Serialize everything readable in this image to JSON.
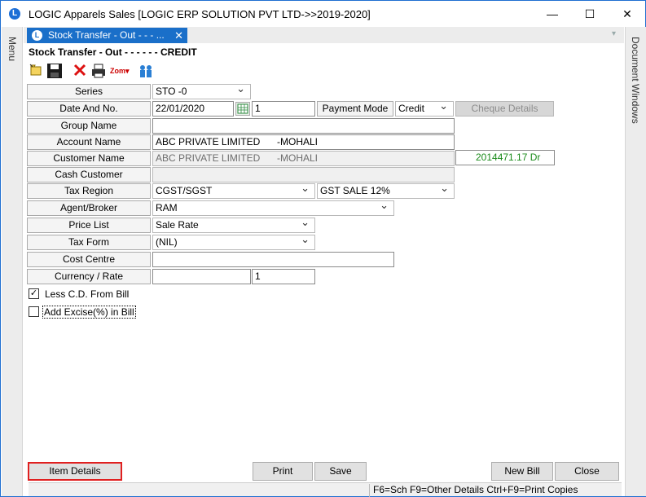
{
  "window": {
    "title": "LOGIC Apparels Sales  [LOGIC ERP SOLUTION PVT LTD->>2019-2020]",
    "logo_letter": "L",
    "minimize": "—",
    "maximize": "☐",
    "close": "✕"
  },
  "sidebars": {
    "left": "Menu",
    "right": "Document Windows"
  },
  "tab": {
    "label": "Stock Transfer - Out -  - - ...",
    "close": "✕",
    "logo_letter": "L",
    "overflow": "▾"
  },
  "form_header": "Stock Transfer - Out -  - - - -  - CREDIT",
  "toolbar": {
    "icons": [
      "new-icon",
      "save-icon",
      "delete-icon",
      "print-icon",
      "zoom-icon",
      "users-icon"
    ],
    "zoom_label": "Zom"
  },
  "fields": {
    "series": {
      "label": "Series",
      "value": "STO -0"
    },
    "date_and_no": {
      "label": "Date And No.",
      "date": "22/01/2020",
      "number": "1"
    },
    "payment_mode": {
      "label": "Payment Mode",
      "value": "Credit"
    },
    "cheque_details": "Cheque Details",
    "group_name": {
      "label": "Group Name",
      "value": ""
    },
    "account_name": {
      "label": "Account Name",
      "name": "ABC PRIVATE LIMITED",
      "city": "-MOHALI"
    },
    "customer_name": {
      "label": "Customer Name",
      "name": "ABC PRIVATE LIMITED",
      "city": "-MOHALI",
      "balance": "2014471.17 Dr"
    },
    "cash_customer": {
      "label": "Cash Customer",
      "value": ""
    },
    "tax_region": {
      "label": "Tax Region",
      "value": "CGST/SGST",
      "tax_type": "GST SALE 12%"
    },
    "agent_broker": {
      "label": "Agent/Broker",
      "value": "RAM"
    },
    "price_list": {
      "label": "Price List",
      "value": "Sale Rate"
    },
    "tax_form": {
      "label": "Tax Form",
      "value": "(NIL)"
    },
    "cost_centre": {
      "label": "Cost Centre",
      "value": ""
    },
    "currency_rate": {
      "label": "Currency / Rate",
      "currency": "",
      "rate": "1"
    }
  },
  "checkboxes": {
    "less_cd": {
      "label": "Less C.D. From Bill",
      "checked": true,
      "mark": "✓"
    },
    "add_excise": {
      "label": "Add Excise(%) in Bill",
      "checked": false,
      "mark": ""
    }
  },
  "buttons": {
    "item_details": "Item Details",
    "print": "Print",
    "save": "Save",
    "new_bill": "New Bill",
    "close": "Close"
  },
  "status": "F6=Sch  F9=Other Details  Ctrl+F9=Print Copies",
  "colors": {
    "accent": "#1a6fc9",
    "balance_text": "#1a8a1a",
    "highlight_border": "#e02020"
  }
}
